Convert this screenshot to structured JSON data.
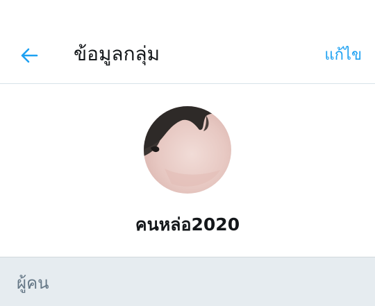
{
  "header": {
    "back_icon": "arrow-left-icon",
    "title": "ข้อมูลกลุ่ม",
    "edit_label": "แก้ไข"
  },
  "profile": {
    "group_name": "คนหล่อ2020"
  },
  "people_section": {
    "label": "ผู้คน"
  },
  "colors": {
    "accent": "#1da1f2",
    "text": "#14171a",
    "section_bg": "#e6ecf0",
    "section_text": "#657786"
  }
}
